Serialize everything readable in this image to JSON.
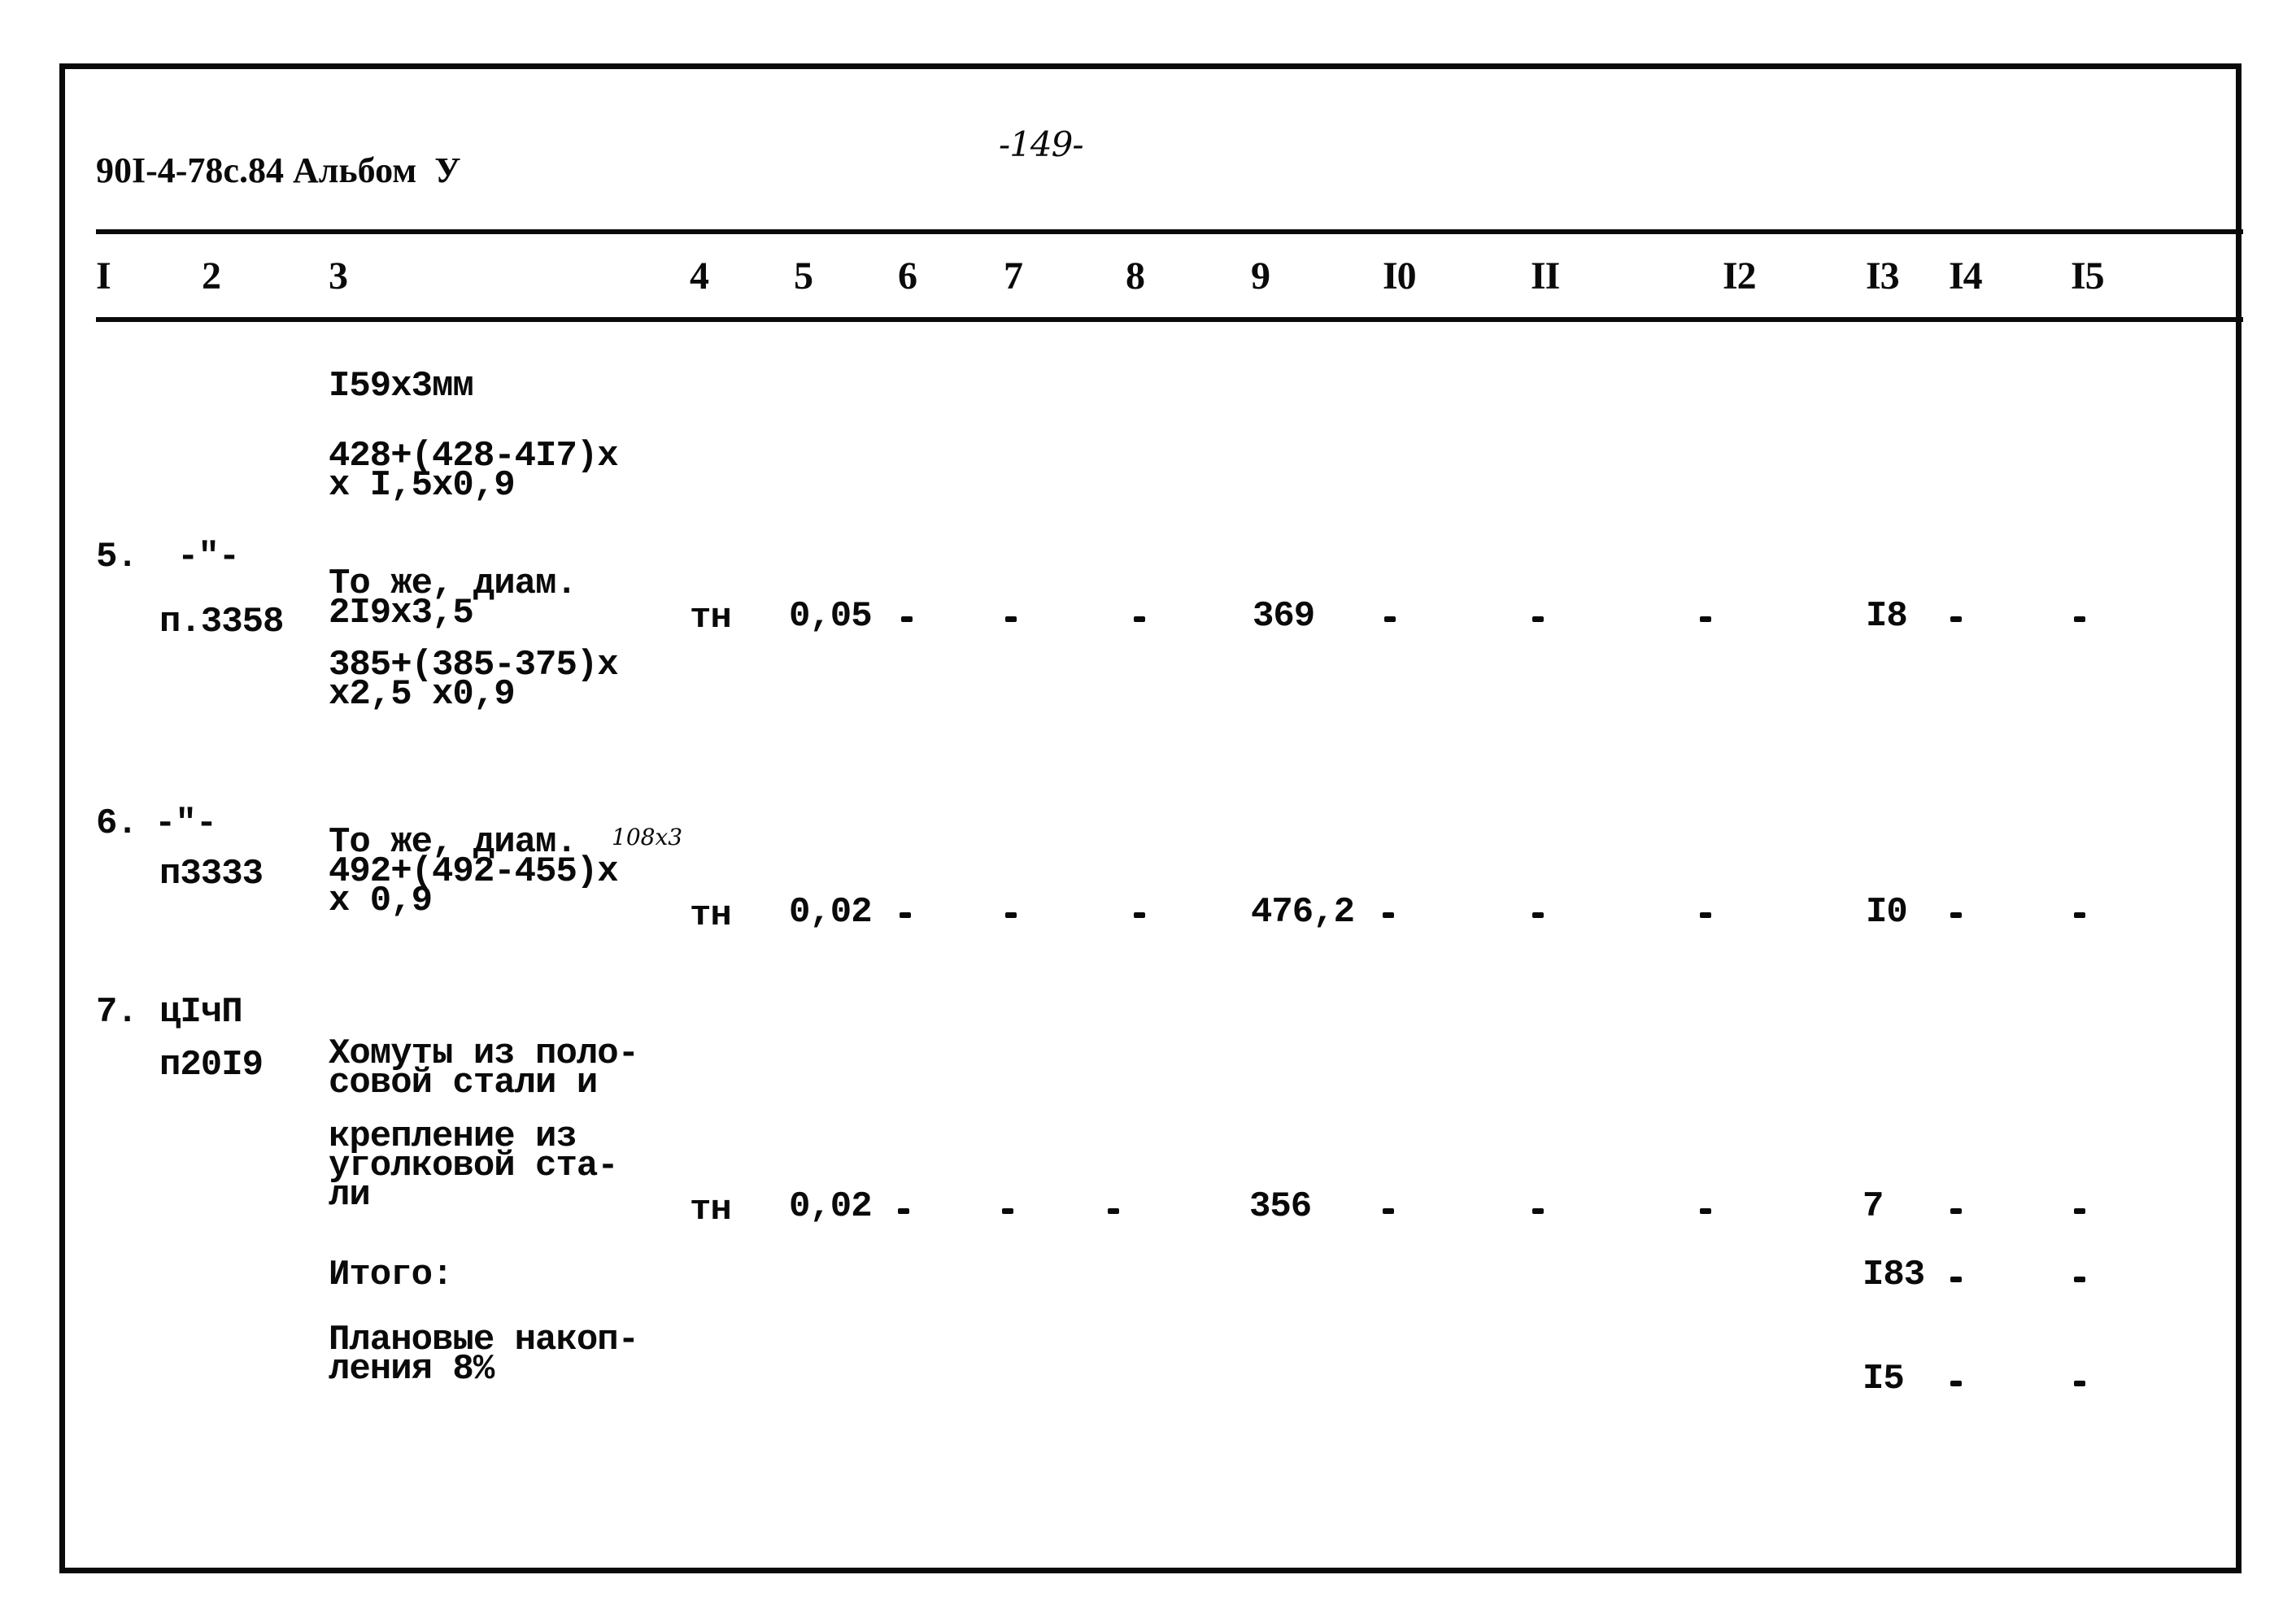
{
  "header": {
    "document_code": "90I-4-78c.84 Альбом  У",
    "page_number": "-149-"
  },
  "column_headers": [
    "I",
    "2",
    "3",
    "4",
    "5",
    "6",
    "7",
    "8",
    "9",
    "I0",
    "II",
    "I2",
    "I3",
    "I4",
    "I5"
  ],
  "rows": [
    {
      "num": "",
      "code": "",
      "description": [
        "I59x3мм",
        "428+(428-4I7)x\nx I,5x0,9"
      ],
      "unit": "",
      "qty": "",
      "c9": "",
      "c13": "",
      "dashes": []
    },
    {
      "num": "5.",
      "code_ditto": "-\"-",
      "code": "п.3358",
      "description": [
        "То же, диам.\n2I9x3,5",
        "385+(385-375)x\nx2,5 x0,9"
      ],
      "unit": "тн",
      "qty": "0,05",
      "c9": "369",
      "c13": "I8",
      "dash_marker": "-"
    },
    {
      "num": "6.",
      "code_ditto": "-\"-",
      "code": "п3333",
      "description": [
        "То же, диам.\n492+(492-455)x\nx 0,9"
      ],
      "handwritten_note": "108x3",
      "unit": "тн",
      "qty": "0,02",
      "c9": "476,2",
      "c13": "I0",
      "dash_marker": "-"
    },
    {
      "num": "7.",
      "code_ditto": "цIчП",
      "code": "п20I9",
      "description": [
        "Хомуты из поло-\nсовой стали и",
        "крепление из\nуголковой ста-\nли"
      ],
      "unit": "тн",
      "qty": "0,02",
      "c9": "356",
      "c13": "7",
      "dash_marker": "-"
    }
  ],
  "totals": {
    "total_label": "Итого:",
    "total_c13": "I83",
    "planned_label": "Плановые накоп-\nления 8%",
    "planned_c13": "I5"
  }
}
